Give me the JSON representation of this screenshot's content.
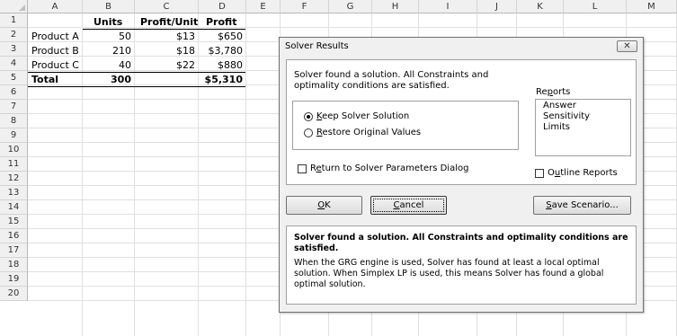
{
  "columns": [
    "A",
    "B",
    "C",
    "D",
    "E",
    "F",
    "G",
    "H",
    "I",
    "J",
    "K",
    "L",
    "M"
  ],
  "rows": [
    "1",
    "2",
    "3",
    "4",
    "5",
    "6",
    "7",
    "8",
    "9",
    "10",
    "11",
    "12",
    "13",
    "14",
    "15",
    "16",
    "17",
    "18",
    "19",
    "20"
  ],
  "table": {
    "headers": {
      "units": "Units",
      "profit_unit": "Profit/Unit",
      "profit": "Profit"
    },
    "data": [
      {
        "name": "Product A",
        "units": "50",
        "profit_unit": "$13",
        "profit": "$650"
      },
      {
        "name": "Product B",
        "units": "210",
        "profit_unit": "$18",
        "profit": "$3,780"
      },
      {
        "name": "Product C",
        "units": "40",
        "profit_unit": "$22",
        "profit": "$880"
      }
    ],
    "total": {
      "name": "Total",
      "units": "300",
      "profit": "$5,310"
    }
  },
  "dialog": {
    "title": "Solver Results",
    "close_glyph": "✕",
    "message_line1": "Solver found a solution.  All Constraints and",
    "message_line2": "optimality conditions are satisfied.",
    "radio_keep": {
      "pre": "",
      "key": "K",
      "post": "eep Solver Solution"
    },
    "radio_restore": {
      "pre": "",
      "key": "R",
      "post": "estore Original Values"
    },
    "return_check": {
      "pre": "R",
      "key": "e",
      "post": "turn to Solver Parameters Dialog"
    },
    "reports_label": {
      "pre": "Re",
      "key": "p",
      "post": "orts"
    },
    "reports": [
      "Answer",
      "Sensitivity",
      "Limits"
    ],
    "outline_check": {
      "pre": "O",
      "key": "u",
      "post": "tline Reports"
    },
    "ok_button": {
      "key": "O",
      "post": "K"
    },
    "cancel_button": {
      "key": "C",
      "post": "ancel"
    },
    "save_button": {
      "key": "S",
      "post": "ave Scenario..."
    },
    "info_bold_line1": "Solver found a solution.  All Constraints and optimality conditions are",
    "info_bold_line2": "satisfied.",
    "info_line1": "When the GRG engine is used, Solver has found at least a local optimal",
    "info_line2": "solution. When Simplex LP is used, this means Solver has found a global",
    "info_line3": "optimal solution."
  }
}
